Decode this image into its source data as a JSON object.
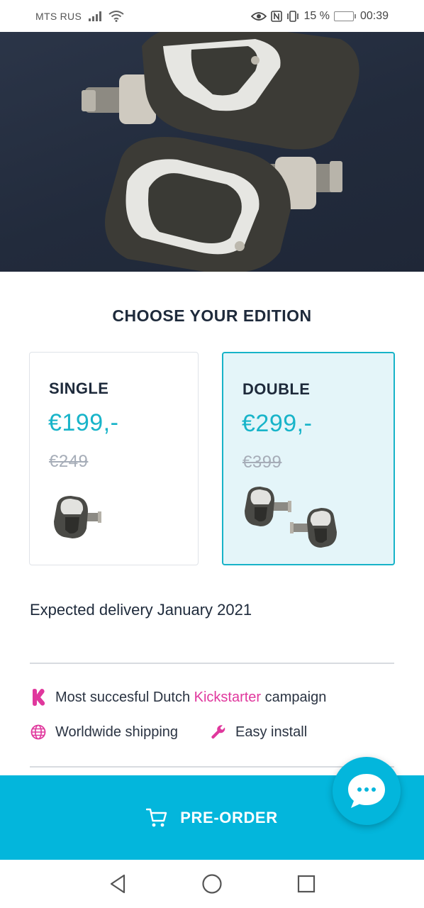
{
  "status_bar": {
    "carrier": "MTS RUS",
    "battery_percent": "15 %",
    "battery_level": 0.15,
    "time": "00:39",
    "icons": [
      "signal-icon",
      "wifi-icon",
      "eye-icon",
      "nfc-icon",
      "vibrate-icon",
      "battery-icon"
    ]
  },
  "hero": {
    "image": "bike-pedals-photo"
  },
  "edition": {
    "title": "CHOOSE YOUR EDITION",
    "cards": [
      {
        "name": "SINGLE",
        "price": "€199,-",
        "old_price": "€249",
        "selected": false,
        "image": "single-pedal-icon"
      },
      {
        "name": "DOUBLE",
        "price": "€299,-",
        "old_price": "€399",
        "selected": true,
        "image": "double-pedal-icon"
      }
    ]
  },
  "delivery": "Expected delivery January 2021",
  "features": {
    "kickstarter": {
      "prefix": "Most succesful Dutch ",
      "link": "Kickstarter",
      "suffix": " campaign",
      "icon": "kickstarter-icon"
    },
    "shipping": {
      "label": "Worldwide shipping",
      "icon": "globe-icon"
    },
    "install": {
      "label": "Easy install",
      "icon": "wrench-icon"
    }
  },
  "cta": {
    "label": "PRE-ORDER",
    "icon": "cart-icon"
  },
  "chat": {
    "icon": "chat-bubble-icon"
  },
  "nav": {
    "icons": [
      "back-icon",
      "home-icon",
      "recents-icon"
    ]
  },
  "colors": {
    "accent": "#03b6dc",
    "price": "#18b4c9",
    "pink": "#e0389d",
    "text": "#1e2a3b"
  }
}
